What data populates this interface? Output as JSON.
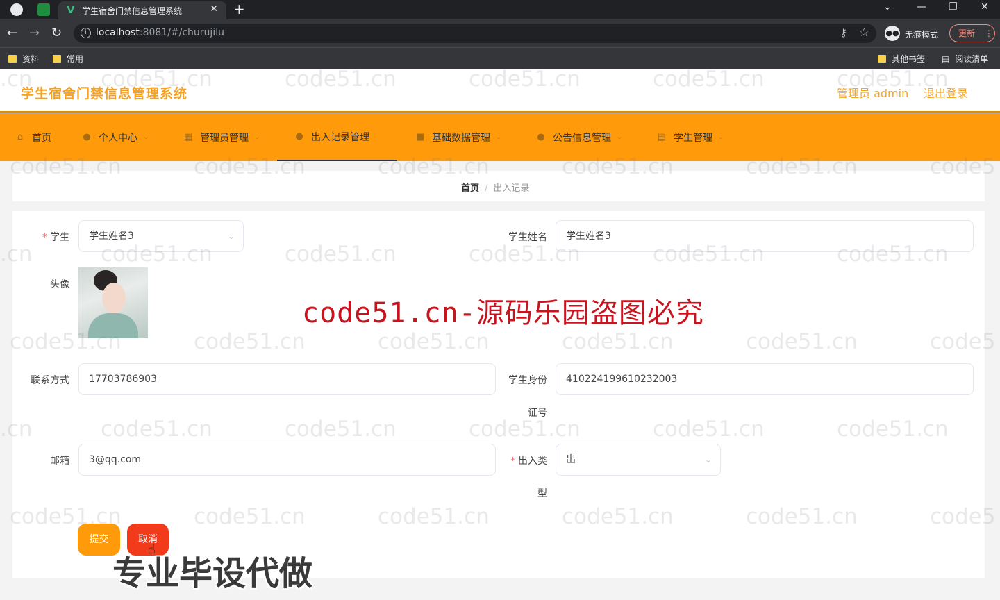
{
  "browser": {
    "tab_title": "学生宿舍门禁信息管理系统",
    "url_host": "localhost",
    "url_rest": ":8081/#/churujilu",
    "incognito_label": "无痕模式",
    "update_label": "更新",
    "bookmarks": [
      "资料",
      "常用"
    ],
    "other_bookmarks": "其他书签",
    "reading_list": "阅读清单"
  },
  "header": {
    "title": "学生宿舍门禁信息管理系统",
    "admin_label": "管理员 admin",
    "logout_label": "退出登录"
  },
  "menu": {
    "items": [
      {
        "label": "首页",
        "icon": "home-icon"
      },
      {
        "label": "个人中心",
        "icon": "user-icon"
      },
      {
        "label": "管理员管理",
        "icon": "grid-icon"
      },
      {
        "label": "出入记录管理",
        "icon": "user-icon"
      },
      {
        "label": "基础数据管理",
        "icon": "chat-icon"
      },
      {
        "label": "公告信息管理",
        "icon": "bell-icon"
      },
      {
        "label": "学生管理",
        "icon": "list-icon"
      }
    ],
    "active": "出入记录管理"
  },
  "breadcrumb": {
    "home": "首页",
    "separator": "/",
    "current": "出入记录"
  },
  "form": {
    "student_label": "学生",
    "student_value": "学生姓名3",
    "student_name_label": "学生姓名",
    "student_name_value": "学生姓名3",
    "avatar_label": "头像",
    "phone_label": "联系方式",
    "phone_value": "17703786903",
    "id_label_line1": "学生身份",
    "id_label_line2": "证号",
    "id_value": "410224199610232003",
    "email_label": "邮箱",
    "email_value": "3@qq.com",
    "type_label_line1": "出入类",
    "type_label_line2": "型",
    "type_value": "出",
    "submit_label": "提交",
    "cancel_label": "取消"
  },
  "watermarks": {
    "tile": "code51.cn",
    "tile_partial_left": ".cn",
    "tile_partial_right": "code5",
    "center": "code51.cn-源码乐园盗图必究",
    "bottom": "专业毕设代做"
  },
  "colors": {
    "accent": "#ff9a0a",
    "title": "#f5a020",
    "cancel": "#f23b1a",
    "watermark_red": "#c8141e"
  }
}
